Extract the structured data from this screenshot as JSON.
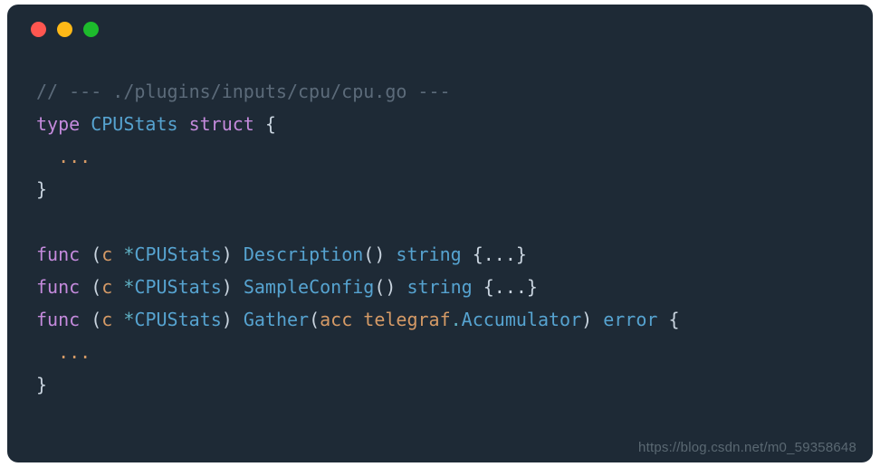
{
  "colors": {
    "bg": "#1e2a36",
    "dot_red": "#ff5650",
    "dot_yellow": "#ffb917",
    "dot_green": "#1dbb2c",
    "comment": "#5c6b7a",
    "keyword": "#c48adc",
    "type": "#56a3d0",
    "ident": "#d59a66",
    "op": "#5fb0c3"
  },
  "code": {
    "comment": "// --- ./plugins/inputs/cpu/cpu.go ---",
    "kw_type": "type",
    "typename": "CPUStats",
    "kw_struct": "struct",
    "brace_open": "{",
    "ellipsis": "...",
    "brace_close": "}",
    "kw_func": "func",
    "recv_open": "(",
    "recv_name": "c",
    "star": "*",
    "recv_close": ")",
    "fn_desc": "Description",
    "fn_sample": "SampleConfig",
    "fn_gather": "Gather",
    "empty_parens": "()",
    "ret_string": "string",
    "inline_body": "{...}",
    "param_acc": "acc",
    "pkg_telegraf": "telegraf",
    "dot": ".",
    "type_accum": "Accumulator",
    "ret_error": "error"
  },
  "watermark": "https://blog.csdn.net/m0_59358648"
}
